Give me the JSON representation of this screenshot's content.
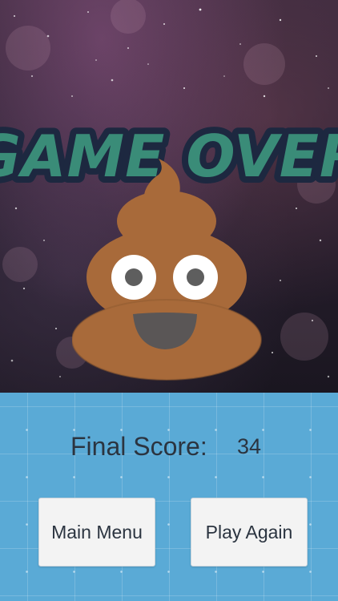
{
  "title": "GAME OVER",
  "score": {
    "label": "Final Score:",
    "value": "34"
  },
  "buttons": {
    "main_menu": "Main Menu",
    "play_again": "Play Again"
  },
  "colors": {
    "title_fill": "#3a8c78",
    "title_outline": "#1d2840",
    "poop_body": "#a86a3a",
    "panel_bg": "#5aaad6",
    "button_bg": "#f3f3f3"
  },
  "icons": {
    "mascot": "poop-emoji-icon"
  }
}
